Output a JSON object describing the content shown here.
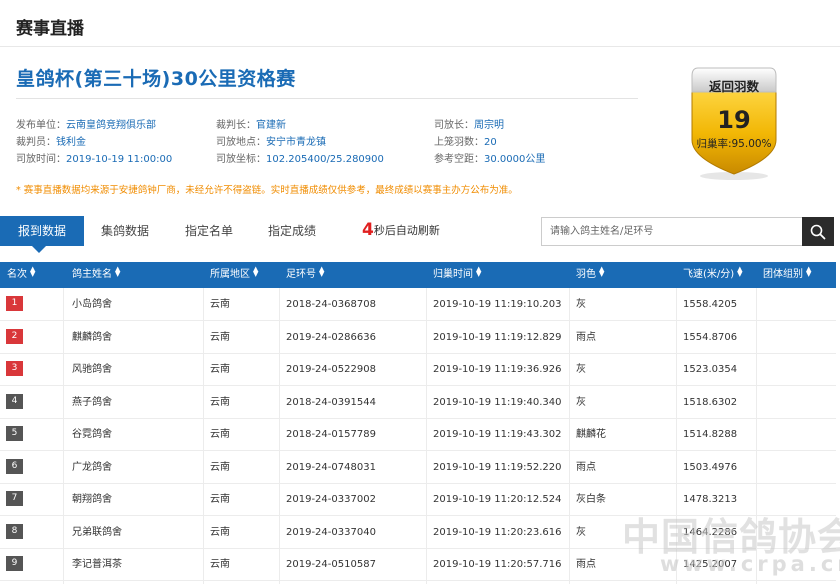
{
  "page": {
    "heading": "赛事直播"
  },
  "race": {
    "title": "皇鸽杯(第三十场)30公里资格赛"
  },
  "info": {
    "publisher_label": "发布单位：",
    "publisher": "云南皇鸽竞翔俱乐部",
    "chief_judge_label": "裁判长：",
    "chief_judge": "官建新",
    "chief_releaser_label": "司放长：",
    "chief_releaser": "周宗明",
    "judge_label": "裁判员：",
    "judge": "钱利金",
    "release_place_label": "司放地点：",
    "release_place": "安宁市青龙镇",
    "count_label": "上笼羽数：",
    "count": "20",
    "release_time_label": "司放时间：",
    "release_time": "2019-10-19 11:00:00",
    "release_coord_label": "司放坐标：",
    "release_coord": "102.205400/25.280900",
    "distance_label": "参考空距：",
    "distance": "30.0000公里"
  },
  "notice": "* 赛事直播数据均来源于安捷鸽钟厂商，未经允许不得盗链。实时直播成绩仅供参考，最终成绩以赛事主办方公布为准。",
  "badge": {
    "label": "返回羽数",
    "count": "19",
    "rate": "归巢率:95.00%"
  },
  "tabs": [
    {
      "label": "报到数据",
      "active": true
    },
    {
      "label": "集鸽数据",
      "active": false
    },
    {
      "label": "指定名单",
      "active": false
    },
    {
      "label": "指定成绩",
      "active": false
    }
  ],
  "countdown": {
    "number": "4",
    "text": "秒后自动刷新"
  },
  "search": {
    "placeholder": "请输入鸽主姓名/足环号"
  },
  "table": {
    "headers": [
      "名次",
      "鸽主姓名",
      "所属地区",
      "足环号",
      "归巢时间",
      "羽色",
      "飞速(米/分)",
      "团体组别"
    ],
    "rows": [
      {
        "rank": "1",
        "owner": "小岛鸽舍",
        "region": "云南",
        "ring": "2018-24-0368708",
        "time": "2019-10-19 11:19:10.203",
        "color": "灰",
        "speed": "1558.4205",
        "group": ""
      },
      {
        "rank": "2",
        "owner": "麒麟鸽舍",
        "region": "云南",
        "ring": "2019-24-0286636",
        "time": "2019-10-19 11:19:12.829",
        "color": "雨点",
        "speed": "1554.8706",
        "group": ""
      },
      {
        "rank": "3",
        "owner": "风驰鸽舍",
        "region": "云南",
        "ring": "2019-24-0522908",
        "time": "2019-10-19 11:19:36.926",
        "color": "灰",
        "speed": "1523.0354",
        "group": ""
      },
      {
        "rank": "4",
        "owner": "燕子鸽舍",
        "region": "云南",
        "ring": "2018-24-0391544",
        "time": "2019-10-19 11:19:40.340",
        "color": "灰",
        "speed": "1518.6302",
        "group": ""
      },
      {
        "rank": "5",
        "owner": "谷霓鸽舍",
        "region": "云南",
        "ring": "2018-24-0157789",
        "time": "2019-10-19 11:19:43.302",
        "color": "麒麟花",
        "speed": "1514.8288",
        "group": ""
      },
      {
        "rank": "6",
        "owner": "广龙鸽舍",
        "region": "云南",
        "ring": "2019-24-0748031",
        "time": "2019-10-19 11:19:52.220",
        "color": "雨点",
        "speed": "1503.4976",
        "group": ""
      },
      {
        "rank": "7",
        "owner": "朝翔鸽舍",
        "region": "云南",
        "ring": "2019-24-0337002",
        "time": "2019-10-19 11:20:12.524",
        "color": "灰白条",
        "speed": "1478.3213",
        "group": ""
      },
      {
        "rank": "8",
        "owner": "兄弟联鸽舍",
        "region": "云南",
        "ring": "2019-24-0337040",
        "time": "2019-10-19 11:20:23.616",
        "color": "灰",
        "speed": "1464.2286",
        "group": ""
      },
      {
        "rank": "9",
        "owner": "李记普洱茶",
        "region": "云南",
        "ring": "2019-24-0510587",
        "time": "2019-10-19 11:20:57.716",
        "color": "雨点",
        "speed": "1425.2007",
        "group": ""
      }
    ]
  },
  "watermark": {
    "cn": "中国信鸽协会",
    "url": "www.crpa.cn"
  },
  "colors": {
    "accent": "#1a6bb5",
    "rank_top": "#d9373a",
    "rank_other": "#555555",
    "notice": "#f08c00",
    "badge_gold": "#e8b400"
  },
  "icons": {
    "search": "search-icon",
    "sort": "sort-icon"
  }
}
